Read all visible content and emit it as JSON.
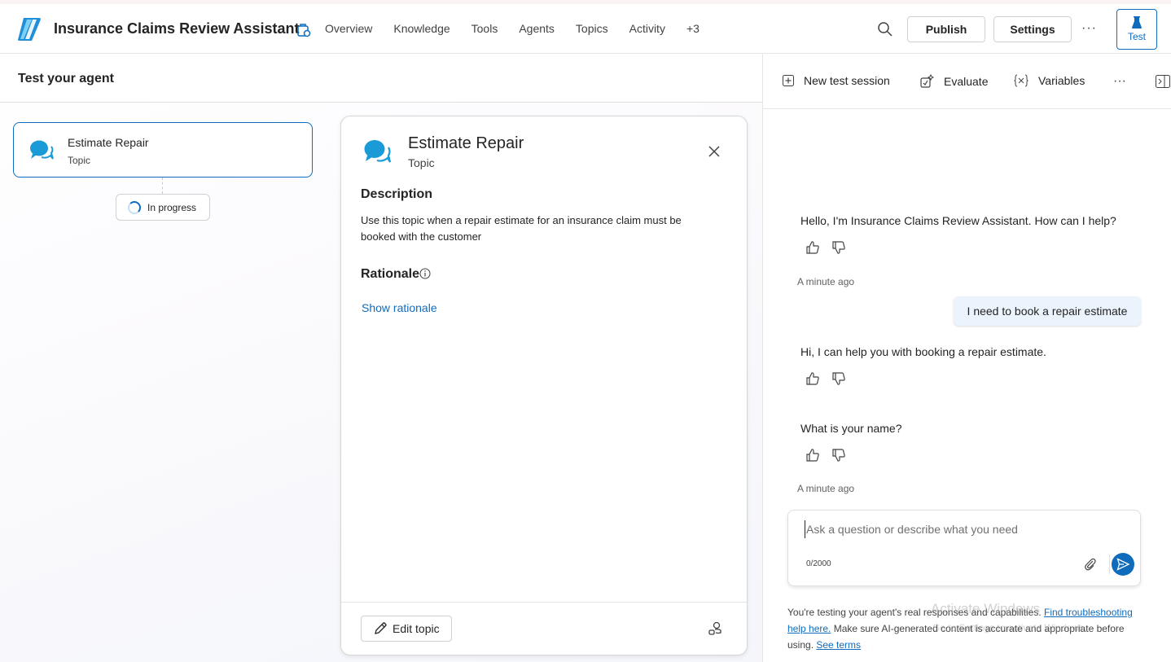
{
  "header": {
    "app_title": "Insurance Claims Review Assistant",
    "nav": [
      "Overview",
      "Knowledge",
      "Tools",
      "Agents",
      "Topics",
      "Activity",
      "+3"
    ],
    "publish_label": "Publish",
    "settings_label": "Settings",
    "more_label": "···",
    "test_label": "Test"
  },
  "left": {
    "title": "Test your agent",
    "node": {
      "title": "Estimate Repair",
      "type": "Topic"
    },
    "status": "In progress"
  },
  "detail": {
    "title": "Estimate Repair",
    "type": "Topic",
    "description_heading": "Description",
    "description": "Use this topic when a repair estimate for an insurance claim must be booked with the customer",
    "rationale_heading": "Rationale",
    "show_rationale": "Show rationale",
    "edit_label": "Edit topic"
  },
  "right": {
    "toolbar": {
      "new_session": "New test session",
      "evaluate": "Evaluate",
      "variables": "Variables",
      "more": "···"
    },
    "messages": {
      "bot1": "Hello, I'm Insurance Claims Review Assistant. How can I help?",
      "time1": "A minute ago",
      "user1": "I need to book a repair estimate",
      "bot2": "Hi, I can help you with booking a repair estimate.",
      "bot3": "What is your name?",
      "time2": "A minute ago"
    },
    "input": {
      "placeholder": "Ask a question or describe what you need",
      "count": "0/2000"
    },
    "disclaimer": {
      "pre": "You're testing your agent's real responses and capabilities. ",
      "link1": "Find troubleshooting help here.",
      "mid": " Make sure AI-generated content is accurate and appropriate before using. ",
      "link2": "See terms"
    },
    "watermark": {
      "line1": "Activate Windows",
      "line2": "Go to Settings to activate Windows."
    }
  },
  "colors": {
    "accent": "#0f6cbd",
    "user_bubble": "#ebf3fc"
  }
}
